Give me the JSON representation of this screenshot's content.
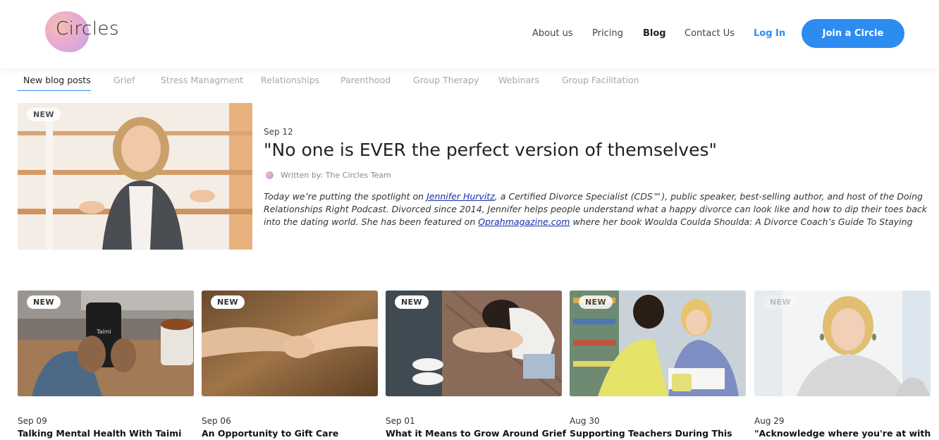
{
  "header": {
    "logo_text": "Circles",
    "nav": [
      {
        "label": "About us"
      },
      {
        "label": "Pricing"
      },
      {
        "label": "Blog"
      },
      {
        "label": "Contact Us"
      }
    ],
    "login_label": "Log In",
    "join_label": "Join a Circle",
    "accent_color": "#2d8cf0"
  },
  "tabs": [
    {
      "label": "New blog posts"
    },
    {
      "label": "Grief"
    },
    {
      "label": "Stress Managment"
    },
    {
      "label": "Relationships"
    },
    {
      "label": "Parenthood"
    },
    {
      "label": "Group Therapy"
    },
    {
      "label": "Webinars"
    },
    {
      "label": "Group Facilitation"
    }
  ],
  "featured": {
    "badge": "NEW",
    "date": "Sep 12",
    "title": "\"No one is EVER the perfect version of themselves\"",
    "author": "Written by: The Circles Team",
    "excerpt_1": "Today we’re putting the spotlight on ",
    "link_1": "Jennifer Hurvitz",
    "excerpt_2": ", a Certified Divorce Specialist (CDS™), public speaker, best-selling author, and host of the Doing Relationships Right Podcast. Divorced since 2014, Jennifer helps people understand what a happy divorce can look like and how to dip their toes back into the dating world. She has been featured on ",
    "link_2": "Oprahmagazine.com",
    "excerpt_3": " where her book Woulda Coulda Shoulda: A Divorce Coach’s Guide To Staying Married was…"
  },
  "cards": [
    {
      "badge": "NEW",
      "date": "Sep 09",
      "title": "Talking Mental Health With Taimi",
      "phone_text": "Taimi"
    },
    {
      "badge": "NEW",
      "date": "Sep 06",
      "title": "An Opportunity to Gift Care"
    },
    {
      "badge": "NEW",
      "date": "Sep 01",
      "title": "What it Means to Grow Around Grief"
    },
    {
      "badge": "NEW",
      "date": "Aug 30",
      "title": "Supporting Teachers During This"
    },
    {
      "badge": "NEW",
      "date": "Aug 29",
      "title": "\"Acknowledge where you're at with"
    }
  ]
}
